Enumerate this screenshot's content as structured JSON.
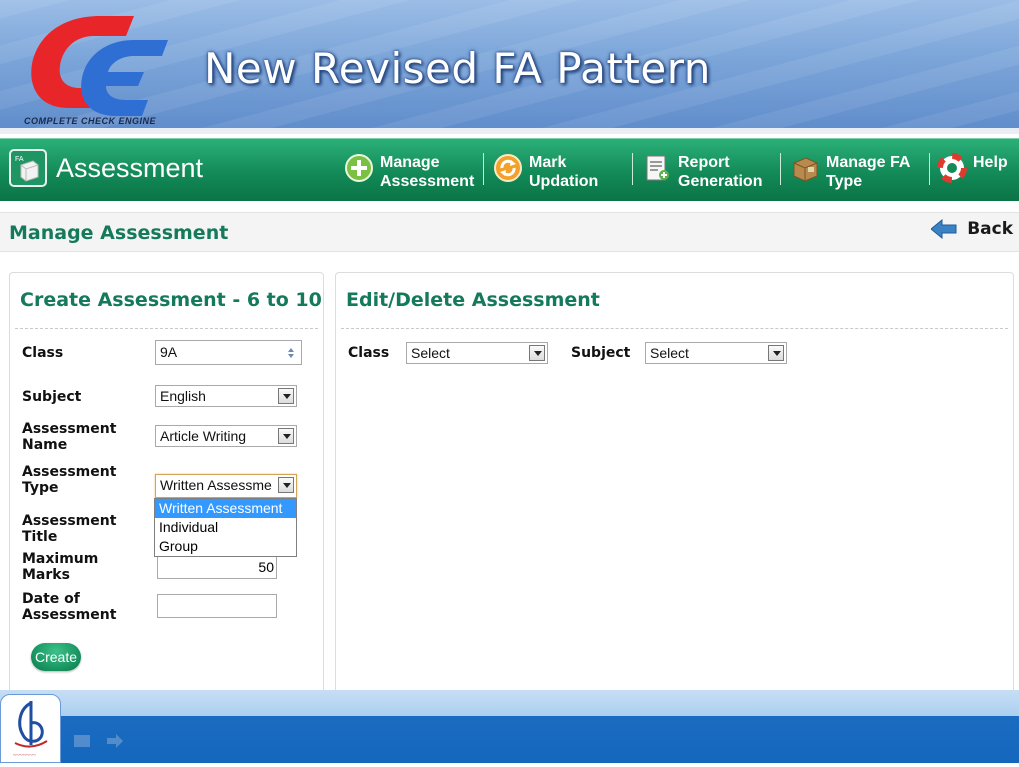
{
  "banner": {
    "title": "New Revised FA Pattern",
    "logo_caption": "COMPLETE CHECK ENGINE"
  },
  "nav": {
    "app_title": "Assessment",
    "items": [
      {
        "line1": "Manage",
        "line2": "Assessment",
        "icon": "plus-circle-icon"
      },
      {
        "line1": "Mark",
        "line2": "Updation",
        "icon": "refresh-icon"
      },
      {
        "line1": "Report",
        "line2": "Generation",
        "icon": "report-icon"
      },
      {
        "line1": "Manage FA",
        "line2": "Type",
        "icon": "box-icon"
      },
      {
        "line1": "Help",
        "line2": "",
        "icon": "lifebuoy-icon"
      }
    ]
  },
  "page": {
    "title": "Manage Assessment",
    "back_label": "Back"
  },
  "create_panel": {
    "title": "Create Assessment - 6 to 10",
    "class_label": "Class",
    "class_value": "9A",
    "subject_label": "Subject",
    "subject_value": "English",
    "assessment_name_label_1": "Assessment",
    "assessment_name_label_2": "Name",
    "assessment_name_value": "Article Writing",
    "assessment_type_label_1": "Assessment",
    "assessment_type_label_2": "Type",
    "assessment_type_value": "Written Assessme",
    "assessment_type_options": [
      "Written Assessment",
      "Individual",
      "Group"
    ],
    "assessment_title_label_1": "Assessment",
    "assessment_title_label_2": "Title",
    "maximum_marks_label_1": "Maximum",
    "maximum_marks_label_2": "Marks",
    "maximum_marks_value": "50",
    "date_label_1": "Date of",
    "date_label_2": "Assessment",
    "date_value": "",
    "create_button": "Create"
  },
  "edit_panel": {
    "title": "Edit/Delete Assessment",
    "class_label": "Class",
    "class_value": "Select",
    "subject_label": "Subject",
    "subject_value": "Select"
  },
  "colors": {
    "nav_green": "#138a58",
    "heading_green": "#157a5b",
    "highlight_blue": "#3399ff",
    "footer_blue": "#1467bd"
  }
}
